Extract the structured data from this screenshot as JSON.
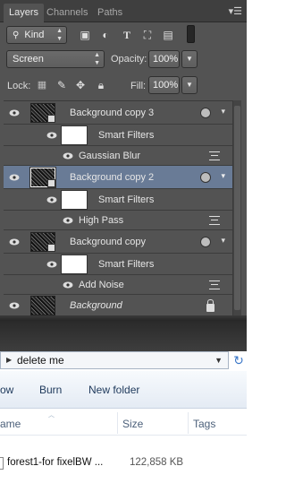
{
  "photoshop": {
    "tabs": [
      "Layers",
      "Channels",
      "Paths"
    ],
    "menu_icon": "panel-menu-icon",
    "filter": {
      "kind_label": "Kind"
    },
    "blend_mode": "Screen",
    "opacity": {
      "label": "Opacity:",
      "value": "100%"
    },
    "lock": {
      "label": "Lock:"
    },
    "fill": {
      "label": "Fill:",
      "value": "100%"
    },
    "layers": [
      {
        "name": "Background copy 3",
        "type": "layer",
        "selected": false
      },
      {
        "name": "Smart Filters",
        "type": "smart-filters"
      },
      {
        "name": "Gaussian Blur",
        "type": "filter"
      },
      {
        "name": "Background copy 2",
        "type": "layer",
        "selected": true
      },
      {
        "name": "Smart Filters",
        "type": "smart-filters"
      },
      {
        "name": "High Pass",
        "type": "filter"
      },
      {
        "name": "Background copy",
        "type": "layer",
        "selected": false
      },
      {
        "name": "Smart Filters",
        "type": "smart-filters"
      },
      {
        "name": "Add Noise",
        "type": "filter"
      },
      {
        "name": "Background",
        "type": "background",
        "locked": true
      }
    ]
  },
  "explorer": {
    "address": "delete me",
    "toolbar": [
      "ow",
      "Burn",
      "New folder"
    ],
    "columns": [
      "ame",
      "Size",
      "Tags"
    ],
    "files": [
      {
        "name": "forest1-for fixelBW ...",
        "size": "122,858 KB"
      }
    ]
  }
}
